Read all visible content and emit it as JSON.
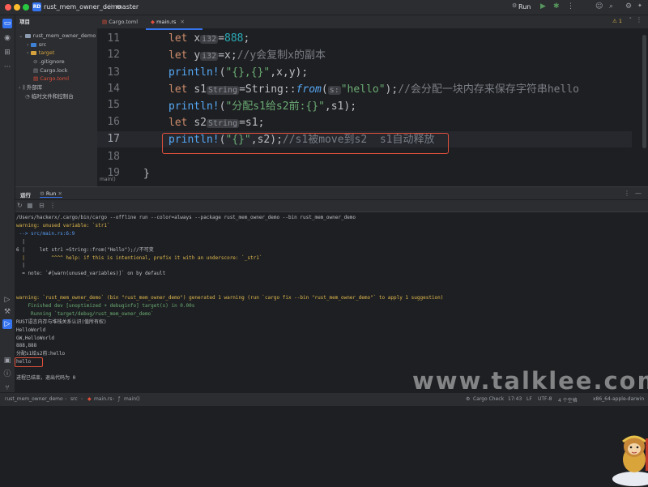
{
  "titlebar": {
    "project_badge": "RD",
    "project_name": "rust_mem_owner_demo",
    "branch": "master",
    "run_config": "Run"
  },
  "project_panel": {
    "title": "项目",
    "items": [
      {
        "label": "rust_mem_owner_demo",
        "type": "folder-root"
      },
      {
        "label": "src",
        "type": "folder"
      },
      {
        "label": "target",
        "type": "folder-excluded"
      },
      {
        "label": ".gitignore",
        "type": "file"
      },
      {
        "label": "Cargo.lock",
        "type": "file"
      },
      {
        "label": "Cargo.toml",
        "type": "file"
      },
      {
        "label": "外部库",
        "type": "library"
      },
      {
        "label": "临时文件和控制台",
        "type": "scratch"
      }
    ]
  },
  "editor": {
    "tabs": [
      {
        "label": "Cargo.toml",
        "active": false
      },
      {
        "label": "main.rs",
        "active": true
      }
    ],
    "line_numbers": [
      "11",
      "12",
      "13",
      "14",
      "15",
      "16",
      "17",
      "18",
      "19"
    ],
    "current_line": "17",
    "inspection_count": "1",
    "breadcrumb": "main()",
    "lines": {
      "l11": {
        "kw": "let",
        "var": "x",
        "hint": "i32",
        "rest_op": "=",
        "num": "888",
        "end": ";"
      },
      "l12": {
        "kw": "let",
        "var": "y",
        "hint": "i32",
        "rest": "=x;",
        "cmt": "//y会复制x的副本"
      },
      "l13": {
        "mac": "println!",
        "open": "(",
        "str": "\"{},{}\"",
        "rest": ",x,y);"
      },
      "l14": {
        "kw": "let",
        "var": "s1",
        "hint": "String",
        "rest_a": "=String::",
        "fn": "from",
        "paren": "(",
        "hint2": "s:",
        "str": "\"hello\"",
        "rest_b": ");",
        "cmt": "//会分配一块内存来保存字符串hello"
      },
      "l15": {
        "mac": "println!",
        "open": "(",
        "str": "\"分配s1给s2前:{}\"",
        "rest": ",s1);"
      },
      "l16": {
        "kw": "let",
        "var": "s2",
        "hint": "String",
        "rest": "=s1;"
      },
      "l17": {
        "mac": "println!",
        "open": "(",
        "str": "\"{}\"",
        "rest": ",s2);",
        "cmt": "//s1被move到s2  s1自动释放"
      },
      "l19": {
        "text": "}"
      }
    }
  },
  "run_panel": {
    "tabs": [
      {
        "label": "运行"
      },
      {
        "label": "Run"
      }
    ],
    "console": [
      {
        "text": "/Users/hackerx/.cargo/bin/cargo --offline run --color=always --package rust_mem_owner_demo --bin rust_mem_owner_demo",
        "cls": ""
      },
      {
        "text": "warning: unused variable: `str1`",
        "cls": "yellow"
      },
      {
        "text": " --> src/main.rs:6:9",
        "cls": "blue"
      },
      {
        "text": "  |",
        "cls": ""
      },
      {
        "text": "6 |     let str1 =String::from(\"Hello\");//不可变",
        "cls": ""
      },
      {
        "text": "  |         ^^^^ help: if this is intentional, prefix it with an underscore: `_str1`",
        "cls": "yellow"
      },
      {
        "text": "  |",
        "cls": ""
      },
      {
        "text": "  = note: `#[warn(unused_variables)]` on by default",
        "cls": ""
      },
      {
        "text": "",
        "cls": ""
      },
      {
        "text": "",
        "cls": ""
      },
      {
        "text": "warning: `rust_mem_owner_demo` (bin \"rust_mem_owner_demo\") generated 1 warning (run `cargo fix --bin \"rust_mem_owner_demo\"` to apply 1 suggestion)",
        "cls": "yellow"
      },
      {
        "text": "    Finished dev [unoptimized + debuginfo] target(s) in 0.00s",
        "cls": "green"
      },
      {
        "text": "     Running `target/debug/rust_mem_owner_demo`",
        "cls": "green"
      },
      {
        "text": "RUST语言内存与堆栈关系认识(值所有权)",
        "cls": ""
      },
      {
        "text": "HelloWorld",
        "cls": ""
      },
      {
        "text": "GW,HelloWorld",
        "cls": ""
      },
      {
        "text": "888,888",
        "cls": ""
      },
      {
        "text": "分配s1给s2前:hello",
        "cls": ""
      },
      {
        "text": "hello",
        "cls": ""
      },
      {
        "text": "",
        "cls": ""
      },
      {
        "text": "进程已结束，退出代码为 0",
        "cls": ""
      }
    ]
  },
  "watermark": "www.talklee.com",
  "statusbar": {
    "path": [
      "rust_mem_owner_demo",
      "src",
      "main.rs",
      "main()"
    ],
    "cargo_check": "Cargo Check",
    "position": "17:43",
    "line_sep": "LF",
    "encoding": "UTF-8",
    "indent": "4 个空格",
    "target": "x86_64-apple-darwin"
  },
  "colors": {
    "accent": "#3574f0",
    "highlight_box": "#e0503b",
    "keyword": "#cf8e6d",
    "string": "#6aab73",
    "macro": "#56a8f5",
    "comment": "#7a7e85",
    "number": "#2aacb8"
  }
}
